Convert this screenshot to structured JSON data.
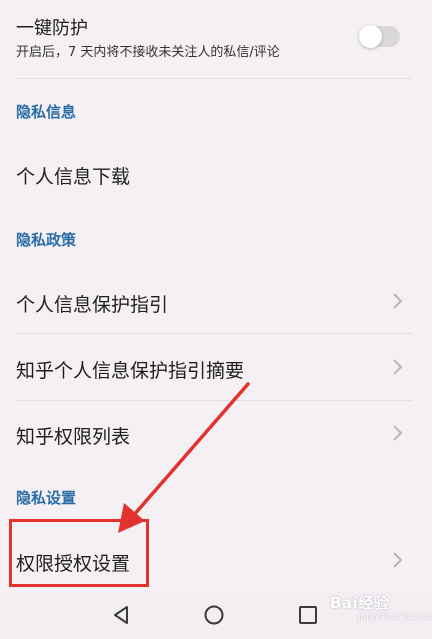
{
  "protect": {
    "title": "一键防护",
    "description": "开启后，7 天内将不接收未关注人的私信/评论",
    "enabled": false
  },
  "sections": [
    {
      "header": "隐私信息",
      "items": [
        {
          "label": "个人信息下载",
          "chevron": false
        }
      ]
    },
    {
      "header": "隐私政策",
      "items": [
        {
          "label": "个人信息保护指引",
          "chevron": true
        },
        {
          "label": "知乎个人信息保护指引摘要",
          "chevron": true
        },
        {
          "label": "知乎权限列表",
          "chevron": true
        }
      ]
    },
    {
      "header": "隐私设置",
      "items": [
        {
          "label": "权限授权设置",
          "chevron": true
        }
      ]
    }
  ],
  "annotation": {
    "color": "#e2322d",
    "target": "权限授权设置"
  },
  "navbar": {
    "buttons": [
      "back-icon",
      "home-icon",
      "recents-icon"
    ]
  },
  "watermark": {
    "text": "Bai经验",
    "sub": "jingyan.baidu.com"
  },
  "colors": {
    "section_header": "#2a6ea8",
    "background": "#f5f0f4"
  }
}
